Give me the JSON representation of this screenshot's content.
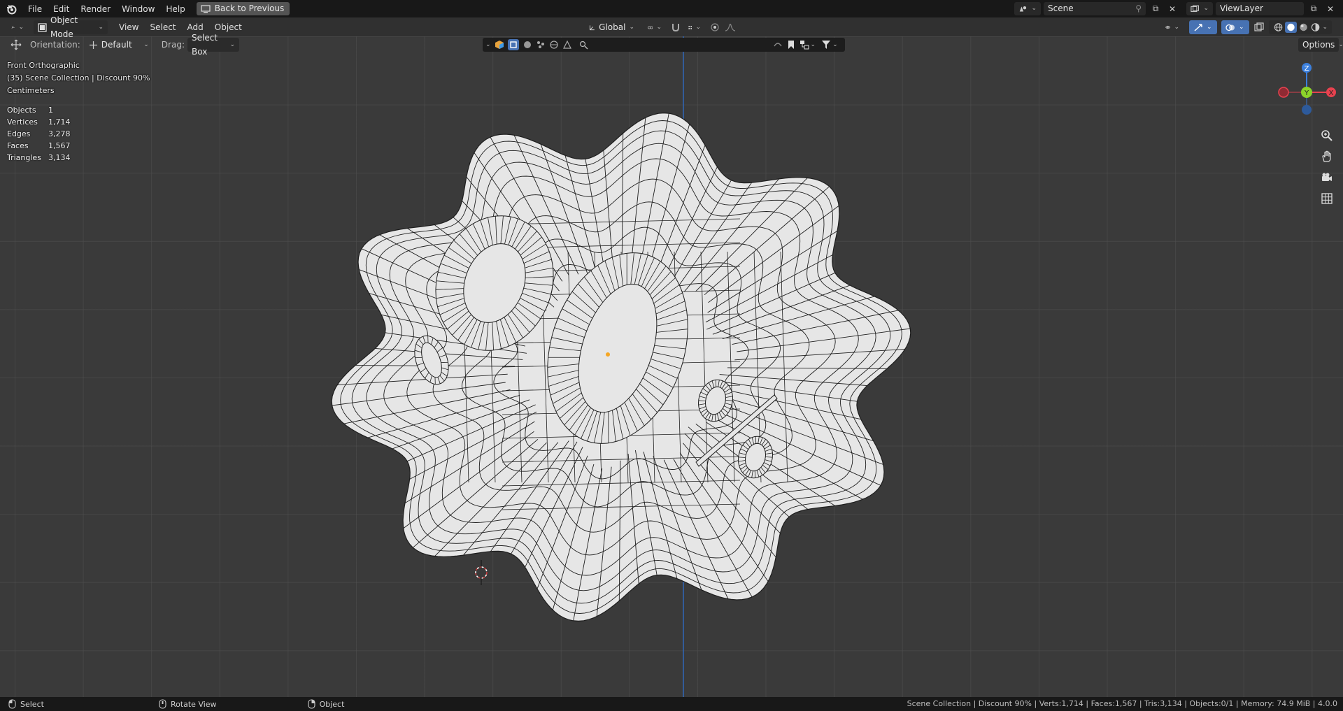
{
  "topbar": {
    "menus": [
      "File",
      "Edit",
      "Render",
      "Window",
      "Help"
    ],
    "back_button": "Back to Previous",
    "scene": "Scene",
    "view_layer": "ViewLayer"
  },
  "header": {
    "editor_type_icon": "3d-viewport-icon",
    "mode": "Object Mode",
    "menus": [
      "View",
      "Select",
      "Add",
      "Object"
    ],
    "transform_orientation": "Global",
    "options_label": "Options"
  },
  "toolsettings": {
    "orientation_label": "Orientation:",
    "orientation_value": "Default",
    "drag_label": "Drag:",
    "drag_value": "Select Box"
  },
  "overlay": {
    "view_name": "Front Orthographic",
    "collection": "(35) Scene Collection | Discount 90%",
    "units": "Centimeters",
    "stats": [
      {
        "key": "Objects",
        "value": "1"
      },
      {
        "key": "Vertices",
        "value": "1,714"
      },
      {
        "key": "Edges",
        "value": "3,278"
      },
      {
        "key": "Faces",
        "value": "1,567"
      },
      {
        "key": "Triangles",
        "value": "3,134"
      }
    ]
  },
  "gizmo": {
    "z": "Z",
    "y": "Y",
    "x": "X"
  },
  "statusbar": {
    "left": [
      {
        "icon": "mouse-left-icon",
        "label": "Select"
      },
      {
        "icon": "mouse-middle-icon",
        "label": "Rotate View"
      },
      {
        "icon": "mouse-right-icon",
        "label": "Object"
      }
    ],
    "right": "Scene Collection | Discount 90% | Verts:1,714 | Faces:1,567 | Tris:3,134 | Objects:0/1 | Memory: 74.9 MiB | 4.0.0"
  },
  "colors": {
    "axis_x": "#e8424f",
    "axis_y": "#8bd22a",
    "axis_z": "#3b7fdd",
    "mesh_fill": "#e6e6e6",
    "wire": "#1e1e1e"
  }
}
